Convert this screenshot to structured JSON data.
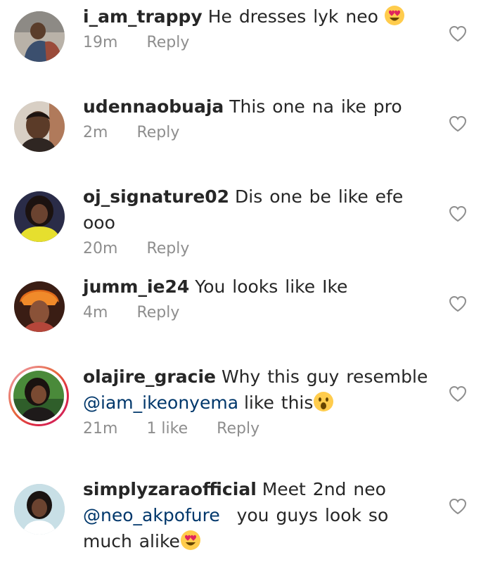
{
  "comments": [
    {
      "username": "i_am_trappy",
      "text": "He dresses lyk neo",
      "emoji": "heart-eyes",
      "time": "19m",
      "likes": "",
      "reply": "Reply"
    },
    {
      "username": "udennaobuaja",
      "text": "This one na ike pro",
      "time": "2m",
      "likes": "",
      "reply": "Reply"
    },
    {
      "username": "oj_signature02",
      "text": "Dis one be like efe ooo",
      "time": "20m",
      "likes": "",
      "reply": "Reply"
    },
    {
      "username": "jumm_ie24",
      "text": "You looks like Ike",
      "time": "4m",
      "likes": "",
      "reply": "Reply"
    },
    {
      "username": "olajire_gracie",
      "text": "Why this guy resemble",
      "mention": "@iam_ikeonyema",
      "text_after": "like this",
      "emoji": "astonished",
      "time": "21m",
      "likes": "1 like",
      "reply": "Reply"
    },
    {
      "username": "simplyzaraofficial",
      "text": "Meet 2nd neo",
      "mention": "@neo_akpofure",
      "text_after": "you guys look so much alike",
      "emoji": "heart-eyes",
      "time": "",
      "likes": "",
      "reply": ""
    }
  ],
  "colors": {
    "text": "#262626",
    "meta": "#8e8e8e",
    "mention": "#00376b",
    "heart_outline": "#8e8e8e"
  }
}
